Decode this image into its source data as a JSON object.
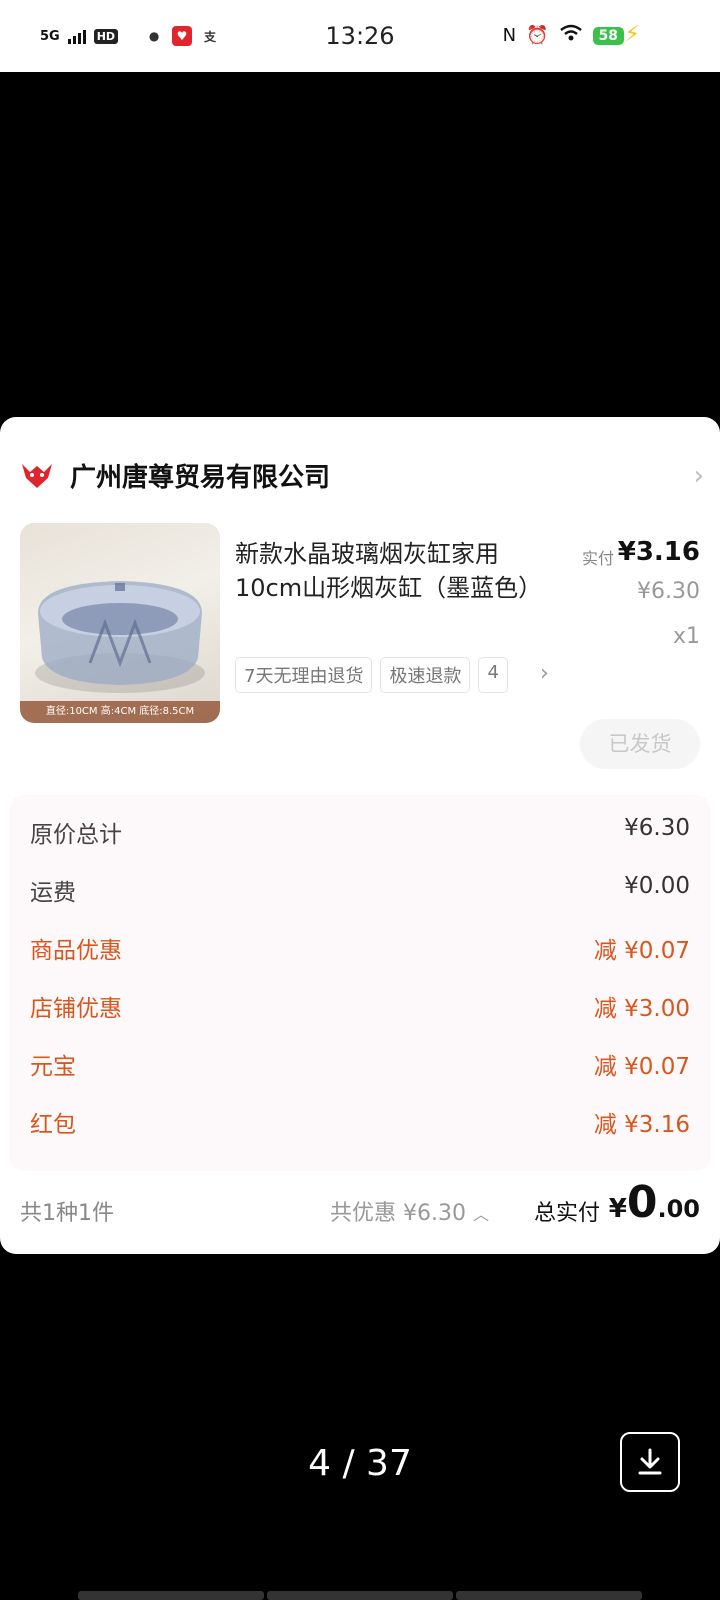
{
  "status_bar": {
    "network": "5G",
    "hd": "HD",
    "time": "13:26",
    "battery": "58"
  },
  "shop": {
    "name": "广州唐尊贸易有限公司"
  },
  "product": {
    "title": "新款水晶玻璃烟灰缸家用10cm山形烟灰缸（墨蓝色）",
    "image_caption": "直径:10CM 高:4CM 底径:8.5CM",
    "paid_label": "实付",
    "paid_price": "¥3.16",
    "original_price": "¥6.30",
    "quantity": "x1",
    "tags": [
      "7天无理由退货",
      "极速退款",
      "4"
    ],
    "status_button": "已发货"
  },
  "fees": [
    {
      "label": "原价总计",
      "value": "¥6.30",
      "discount": false
    },
    {
      "label": "运费",
      "value": "¥0.00",
      "discount": false
    },
    {
      "label": "商品优惠",
      "value": "减 ¥0.07",
      "discount": true
    },
    {
      "label": "店铺优惠",
      "value": "减 ¥3.00",
      "discount": true
    },
    {
      "label": "元宝",
      "value": "减 ¥0.07",
      "discount": true
    },
    {
      "label": "红包",
      "value": "减 ¥3.16",
      "discount": true
    }
  ],
  "summary": {
    "count": "共1种1件",
    "total_discount": "共优惠 ¥6.30",
    "total_label": "总实付",
    "total_currency": "¥",
    "total_integer": "0",
    "total_decimal": ".00"
  },
  "viewer": {
    "pager": "4 / 37"
  },
  "colors": {
    "discount": "#d9561c",
    "shop_logo": "#e0262c",
    "battery": "#39c24a"
  },
  "icons": [
    "signal-icon",
    "wechat-icon",
    "alipay-icon",
    "nfc-icon",
    "alarm-icon",
    "wifi-icon",
    "charging-icon",
    "shop-logo-icon",
    "chevron-right-icon",
    "chevron-up-icon",
    "download-icon"
  ]
}
